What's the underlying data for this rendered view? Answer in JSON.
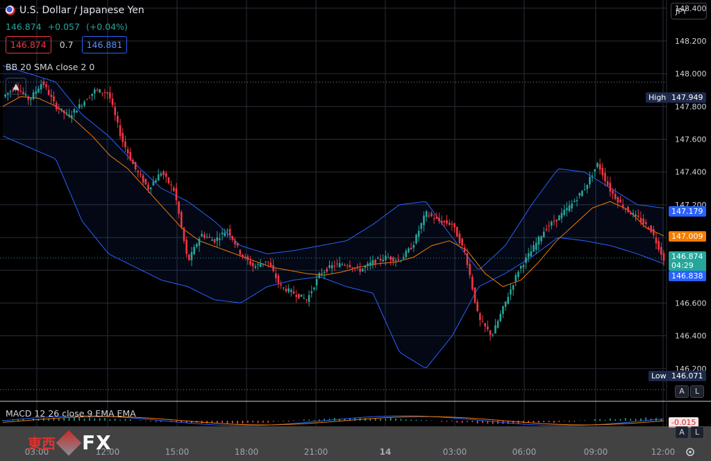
{
  "header": {
    "symbol": "U.S. Dollar / Japanese Yen",
    "last": "146.874",
    "change": "+0.057",
    "change_pct": "(+0.04%)",
    "bid": "146.874",
    "ask": "146.881",
    "spread": "0.7",
    "indicator": "BB 20 SMA close 2 0",
    "currency_button": "JPY"
  },
  "macd_label": "MACD 12 26 close 9 EMA EMA",
  "macd_value": "-0.015",
  "tags": {
    "high_label": "High",
    "high_value": "147.949",
    "upper_value": "147.179",
    "mid_value": "147.009",
    "last_value": "146.874",
    "countdown": "04:29",
    "lower_value": "146.838",
    "low_label": "Low",
    "low_value": "146.071"
  },
  "buttons": {
    "auto": "A",
    "log": "L"
  },
  "watermark": {
    "cn": "東西",
    "fx": "FX"
  },
  "colors": {
    "up": "#26a69a",
    "down": "#f23645",
    "band": "#2962ff",
    "basis": "#f57c00",
    "bg": "#000000"
  },
  "chart_data": {
    "type": "candlestick",
    "title": "U.S. Dollar / Japanese Yen",
    "y_ticks": [
      "148.400",
      "148.200",
      "148.000",
      "147.800",
      "147.600",
      "147.400",
      "147.200",
      "147.000",
      "146.800",
      "146.600",
      "146.400",
      "146.200"
    ],
    "ylim": [
      146.0,
      148.45
    ],
    "x_ticks": [
      "03:00",
      "12:00",
      "15:00",
      "18:00",
      "21:00",
      "14",
      "03:00",
      "06:00",
      "09:00",
      "12:00"
    ],
    "grid": true,
    "price_series": [
      147.86,
      147.92,
      147.84,
      147.95,
      147.8,
      147.74,
      147.82,
      147.9,
      147.88,
      147.6,
      147.42,
      147.3,
      147.4,
      147.28,
      146.85,
      147.02,
      146.98,
      147.05,
      146.9,
      146.82,
      146.86,
      146.7,
      146.66,
      146.62,
      146.78,
      146.83,
      146.84,
      146.8,
      146.85,
      146.88,
      146.86,
      146.95,
      147.15,
      147.1,
      147.08,
      146.9,
      146.5,
      146.4,
      146.6,
      146.8,
      146.92,
      147.05,
      147.12,
      147.2,
      147.3,
      147.45,
      147.28,
      147.18,
      147.12,
      147.05,
      146.87
    ],
    "basis": [
      147.8,
      147.86,
      147.85,
      147.8,
      147.72,
      147.62,
      147.5,
      147.42,
      147.3,
      147.18,
      147.06,
      146.98,
      146.94,
      146.9,
      146.86,
      146.82,
      146.8,
      146.78,
      146.77,
      146.79,
      146.82,
      146.84,
      146.85,
      146.88,
      146.95,
      146.98,
      146.92,
      146.78,
      146.7,
      146.74,
      146.85,
      146.98,
      147.08,
      147.18,
      147.22,
      147.17,
      147.06,
      147.01
    ],
    "upper": [
      148.05,
      148.0,
      147.95,
      147.75,
      147.62,
      147.45,
      147.3,
      147.22,
      147.1,
      146.95,
      146.9,
      146.92,
      146.95,
      146.98,
      147.08,
      147.2,
      147.22,
      147.0,
      146.8,
      146.95,
      147.2,
      147.42,
      147.4,
      147.3,
      147.2,
      147.18
    ],
    "lower": [
      147.62,
      147.55,
      147.48,
      147.1,
      146.9,
      146.82,
      146.74,
      146.7,
      146.62,
      146.6,
      146.7,
      146.74,
      146.76,
      146.7,
      146.66,
      146.3,
      146.2,
      146.4,
      146.7,
      146.78,
      146.88,
      147.0,
      146.98,
      146.95,
      146.9,
      146.84
    ],
    "high": 147.949,
    "low": 146.071,
    "last": 146.874
  }
}
